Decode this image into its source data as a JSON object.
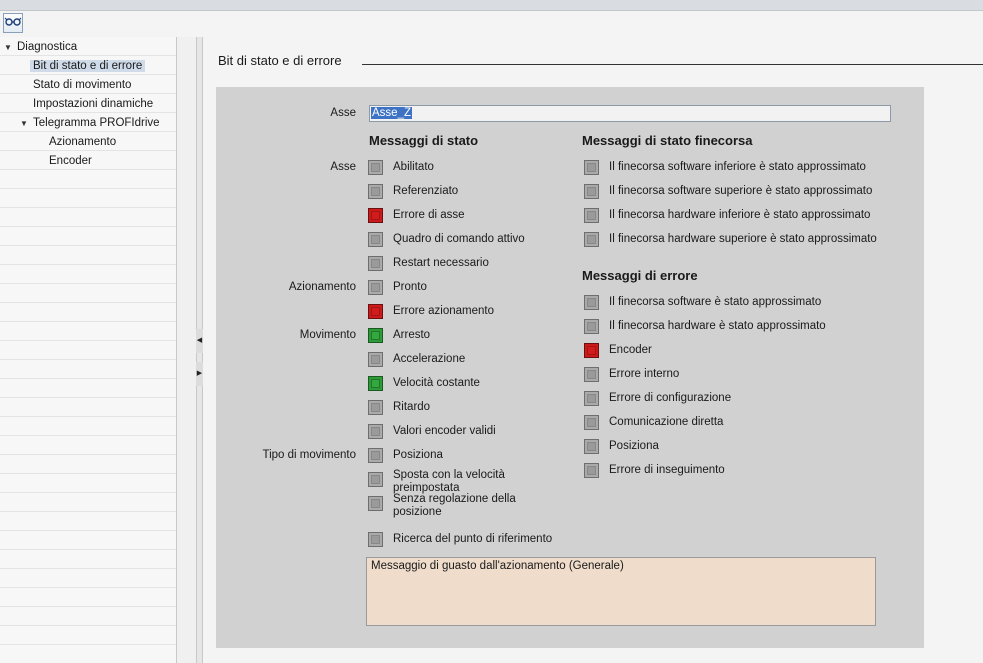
{
  "tree": {
    "items": [
      {
        "label": "Diagnostica",
        "expanded": true
      },
      {
        "label": "Bit di stato e di errore",
        "selected": true
      },
      {
        "label": "Stato di movimento"
      },
      {
        "label": "Impostazioni dinamiche"
      },
      {
        "label": "Telegramma PROFIdrive",
        "expanded": true
      },
      {
        "label": "Azionamento"
      },
      {
        "label": "Encoder"
      }
    ]
  },
  "section": {
    "title": "Bit di stato e di errore"
  },
  "axis": {
    "label": "Asse",
    "value": "Asse_Z"
  },
  "status": {
    "title": "Messaggi di stato",
    "group_labels": {
      "axis": "Asse",
      "drive": "Azionamento",
      "motion": "Movimento",
      "motion_type": "Tipo di movimento"
    },
    "items": [
      {
        "label": "Abilitato",
        "state": "off"
      },
      {
        "label": "Referenziato",
        "state": "off"
      },
      {
        "label": "Errore di asse",
        "state": "error"
      },
      {
        "label": "Quadro di comando attivo",
        "state": "off"
      },
      {
        "label": "Restart necessario",
        "state": "off"
      },
      {
        "label": "Pronto",
        "state": "off"
      },
      {
        "label": "Errore azionamento",
        "state": "error"
      },
      {
        "label": "Arresto",
        "state": "ok"
      },
      {
        "label": "Accelerazione",
        "state": "off"
      },
      {
        "label": "Velocità costante",
        "state": "ok"
      },
      {
        "label": "Ritardo",
        "state": "off"
      },
      {
        "label": "Valori encoder validi",
        "state": "off"
      },
      {
        "label": "Posiziona",
        "state": "off"
      },
      {
        "label": "Sposta con la velocità preimpostata",
        "state": "off"
      },
      {
        "label": "Senza regolazione della posizione",
        "state": "off"
      },
      {
        "label": "Ricerca del punto di riferimento",
        "state": "off"
      }
    ]
  },
  "limit_status": {
    "title": "Messaggi di stato finecorsa",
    "items": [
      {
        "label": "Il finecorsa software inferiore è stato approssimato",
        "state": "off"
      },
      {
        "label": "Il finecorsa software superiore è stato approssimato",
        "state": "off"
      },
      {
        "label": "Il finecorsa hardware inferiore è stato approssimato",
        "state": "off"
      },
      {
        "label": "Il finecorsa hardware superiore è stato approssimato",
        "state": "off"
      }
    ]
  },
  "errors": {
    "title": "Messaggi di errore",
    "items": [
      {
        "label": "Il finecorsa software è stato approssimato",
        "state": "off"
      },
      {
        "label": "Il finecorsa hardware è stato approssimato",
        "state": "off"
      },
      {
        "label": "Encoder",
        "state": "error"
      },
      {
        "label": "Errore interno",
        "state": "off"
      },
      {
        "label": "Errore di configurazione",
        "state": "off"
      },
      {
        "label": "Comunicazione diretta",
        "state": "off"
      },
      {
        "label": "Posiziona",
        "state": "off"
      },
      {
        "label": "Errore di inseguimento",
        "state": "off"
      }
    ]
  },
  "fault_message": "Messaggio di guasto dall'azionamento (Generale)",
  "colors": {
    "error": "#cc1a1a",
    "ok": "#2c9c38",
    "off": "#aaaaaa"
  }
}
